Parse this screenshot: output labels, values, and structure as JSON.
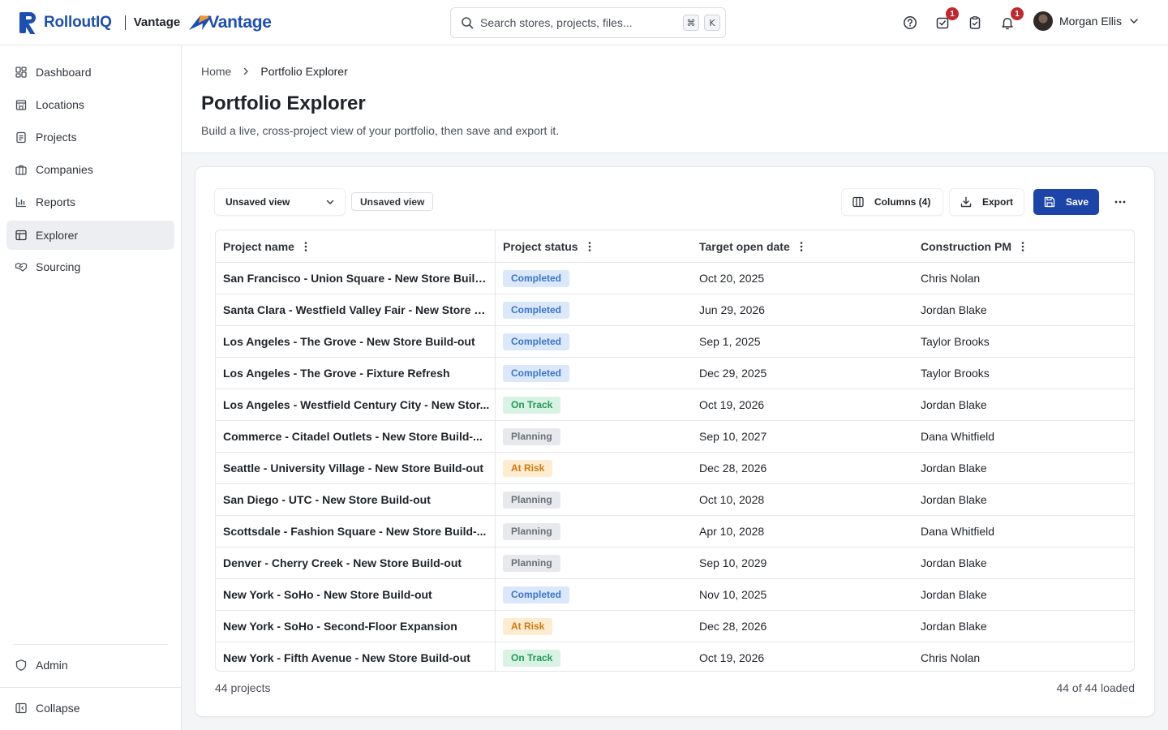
{
  "brand": {
    "name": "RolloutIQ",
    "product": "Vantage",
    "logo_word": "Vantage",
    "color": "#1d4fb3"
  },
  "search": {
    "placeholder": "Search stores, projects, files...",
    "shortcut_mod": "⌘",
    "shortcut_key": "K"
  },
  "top_icons": [
    {
      "icon": "help-circle-icon"
    },
    {
      "icon": "task-check-icon",
      "badge": "1"
    },
    {
      "icon": "clipboard-check-icon"
    },
    {
      "icon": "bell-icon",
      "badge": "1"
    }
  ],
  "user": {
    "name": "Morgan Ellis"
  },
  "sidebar": {
    "items": [
      {
        "label": "Dashboard",
        "icon": "dashboard-icon"
      },
      {
        "label": "Locations",
        "icon": "building-icon"
      },
      {
        "label": "Projects",
        "icon": "clipboard-icon"
      },
      {
        "label": "Companies",
        "icon": "briefcase-icon"
      },
      {
        "label": "Reports",
        "icon": "bar-chart-icon"
      },
      {
        "label": "Explorer",
        "icon": "table-icon",
        "active": true
      },
      {
        "label": "Sourcing",
        "icon": "handshake-icon"
      }
    ],
    "admin": "Admin",
    "collapse": "Collapse"
  },
  "breadcrumb": {
    "home": "Home",
    "current": "Portfolio Explorer"
  },
  "page": {
    "title": "Portfolio Explorer",
    "subtitle": "Build a live, cross-project view of your portfolio, then save and export it."
  },
  "toolbar": {
    "view_select": "Unsaved view",
    "view_tag": "Unsaved view",
    "columns_label": "Columns (4)",
    "export_label": "Export",
    "save_label": "Save",
    "primary_color": "#1d44a8"
  },
  "table": {
    "columns": [
      "Project name",
      "Project status",
      "Target open date",
      "Construction PM"
    ],
    "rows": [
      {
        "name": "San Francisco - Union Square - New Store Build...",
        "status": "Completed",
        "date": "Oct 20, 2025",
        "pm": "Chris Nolan"
      },
      {
        "name": "Santa Clara - Westfield Valley Fair - New Store B...",
        "status": "Completed",
        "date": "Jun 29, 2026",
        "pm": "Jordan Blake"
      },
      {
        "name": "Los Angeles - The Grove - New Store Build-out",
        "status": "Completed",
        "date": "Sep 1, 2025",
        "pm": "Taylor Brooks"
      },
      {
        "name": "Los Angeles - The Grove - Fixture Refresh",
        "status": "Completed",
        "date": "Dec 29, 2025",
        "pm": "Taylor Brooks"
      },
      {
        "name": "Los Angeles - Westfield Century City - New Stor...",
        "status": "On Track",
        "date": "Oct 19, 2026",
        "pm": "Jordan Blake"
      },
      {
        "name": "Commerce - Citadel Outlets - New Store Build-...",
        "status": "Planning",
        "date": "Sep 10, 2027",
        "pm": "Dana Whitfield"
      },
      {
        "name": "Seattle - University Village - New Store Build-out",
        "status": "At Risk",
        "date": "Dec 28, 2026",
        "pm": "Jordan Blake"
      },
      {
        "name": "San Diego - UTC - New Store Build-out",
        "status": "Planning",
        "date": "Oct 10, 2028",
        "pm": "Jordan Blake"
      },
      {
        "name": "Scottsdale - Fashion Square - New Store Build-...",
        "status": "Planning",
        "date": "Apr 10, 2028",
        "pm": "Dana Whitfield"
      },
      {
        "name": "Denver - Cherry Creek - New Store Build-out",
        "status": "Planning",
        "date": "Sep 10, 2029",
        "pm": "Jordan Blake"
      },
      {
        "name": "New York - SoHo - New Store Build-out",
        "status": "Completed",
        "date": "Nov 10, 2025",
        "pm": "Jordan Blake"
      },
      {
        "name": "New York - SoHo - Second-Floor Expansion",
        "status": "At Risk",
        "date": "Dec 28, 2026",
        "pm": "Jordan Blake"
      },
      {
        "name": "New York - Fifth Avenue - New Store Build-out",
        "status": "On Track",
        "date": "Oct 19, 2026",
        "pm": "Chris Nolan"
      }
    ],
    "status_colors": {
      "Completed": "#3a74c9",
      "On Track": "#23995a",
      "Planning": "#6b7079",
      "At Risk": "#d07a10"
    }
  },
  "footer": {
    "count": "44 projects",
    "loaded": "44 of 44 loaded"
  }
}
